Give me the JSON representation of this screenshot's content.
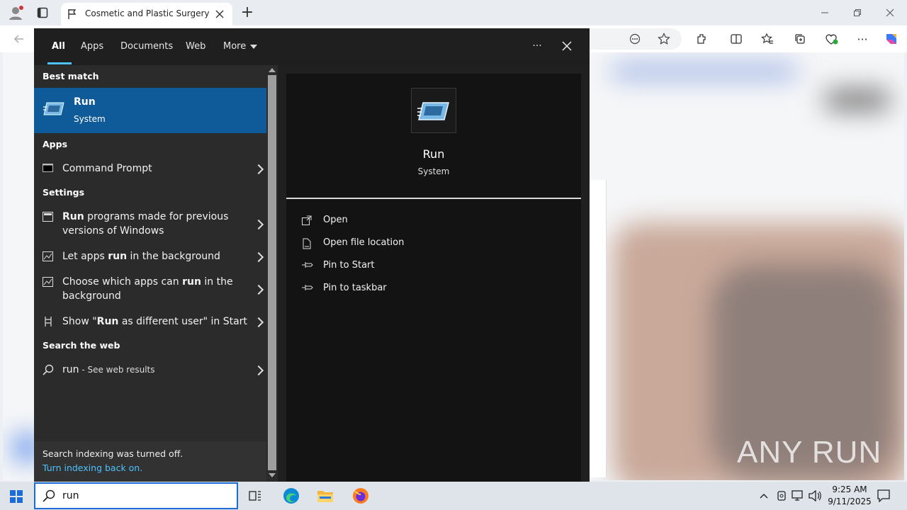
{
  "browser": {
    "tab_title": "Cosmetic and Plastic Surgery Surg",
    "new_tab_symbol": "+"
  },
  "search": {
    "tabs": [
      {
        "label": "All",
        "active": true
      },
      {
        "label": "Apps"
      },
      {
        "label": "Documents"
      },
      {
        "label": "Web"
      },
      {
        "label": "More"
      }
    ],
    "more_menu_symbol": "···",
    "best_match_heading": "Best match",
    "best_match": {
      "title": "Run",
      "subtitle": "System"
    },
    "apps_heading": "Apps",
    "apps": [
      {
        "label": "Command Prompt"
      }
    ],
    "settings_heading": "Settings",
    "settings": [
      {
        "pre": "",
        "bold": "Run",
        "post": " programs made for previous",
        "line2": "versions of Windows"
      },
      {
        "pre": "Let apps ",
        "bold": "run",
        "post": " in the background",
        "line2": ""
      },
      {
        "pre": "Choose which apps can ",
        "bold": "run",
        "post": " in the",
        "line2": "background"
      },
      {
        "pre": "Show \"",
        "bold": "Run",
        "post": " as different user\" in Start",
        "line2": ""
      }
    ],
    "web_heading": "Search the web",
    "web_result": {
      "query": "run",
      "suffix": " - See web results"
    },
    "indexing_note": "Search indexing was turned off.",
    "indexing_link": "Turn indexing back on.",
    "detail": {
      "title": "Run",
      "subtitle": "System",
      "actions": [
        {
          "label": "Open",
          "icon": "open-icon"
        },
        {
          "label": "Open file location",
          "icon": "file-location-icon"
        },
        {
          "label": "Pin to Start",
          "icon": "pin-icon"
        },
        {
          "label": "Pin to taskbar",
          "icon": "pin-icon"
        }
      ]
    }
  },
  "taskbar": {
    "search_value": "run",
    "time": "9:25 AM",
    "date": "9/11/2025"
  },
  "watermark": "ANY RUN",
  "colors": {
    "accent": "#4cc2ff",
    "selected": "#0f5a99",
    "link": "#4cc2ff"
  }
}
